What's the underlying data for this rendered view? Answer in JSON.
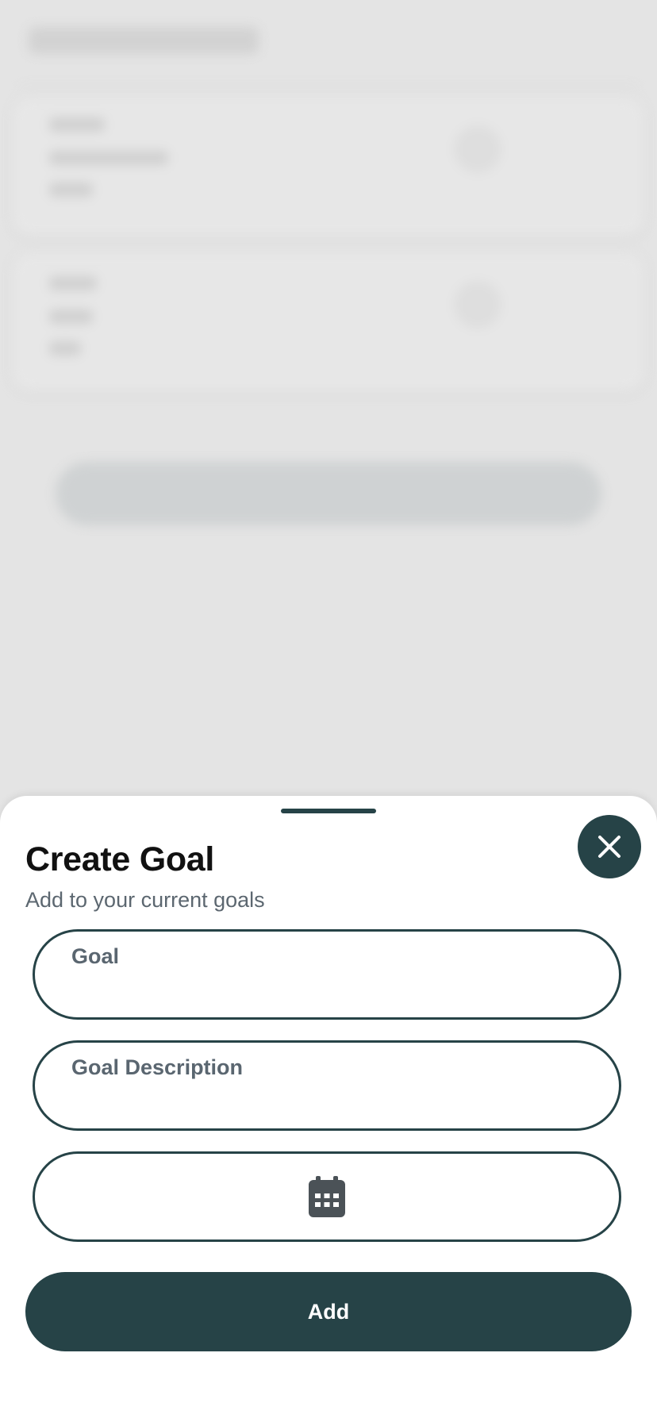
{
  "sheet": {
    "title": "Create Goal",
    "subtitle": "Add to your current goals",
    "close_icon": "close-icon",
    "fields": {
      "goal": {
        "label": "Goal",
        "value": ""
      },
      "description": {
        "label": "Goal Description",
        "value": ""
      },
      "date": {
        "icon": "calendar-icon",
        "value": ""
      }
    },
    "add_label": "Add"
  },
  "colors": {
    "primary": "#264347",
    "title_text": "#111111",
    "muted_text": "#5c6770",
    "backdrop": "#e4e4e4"
  }
}
